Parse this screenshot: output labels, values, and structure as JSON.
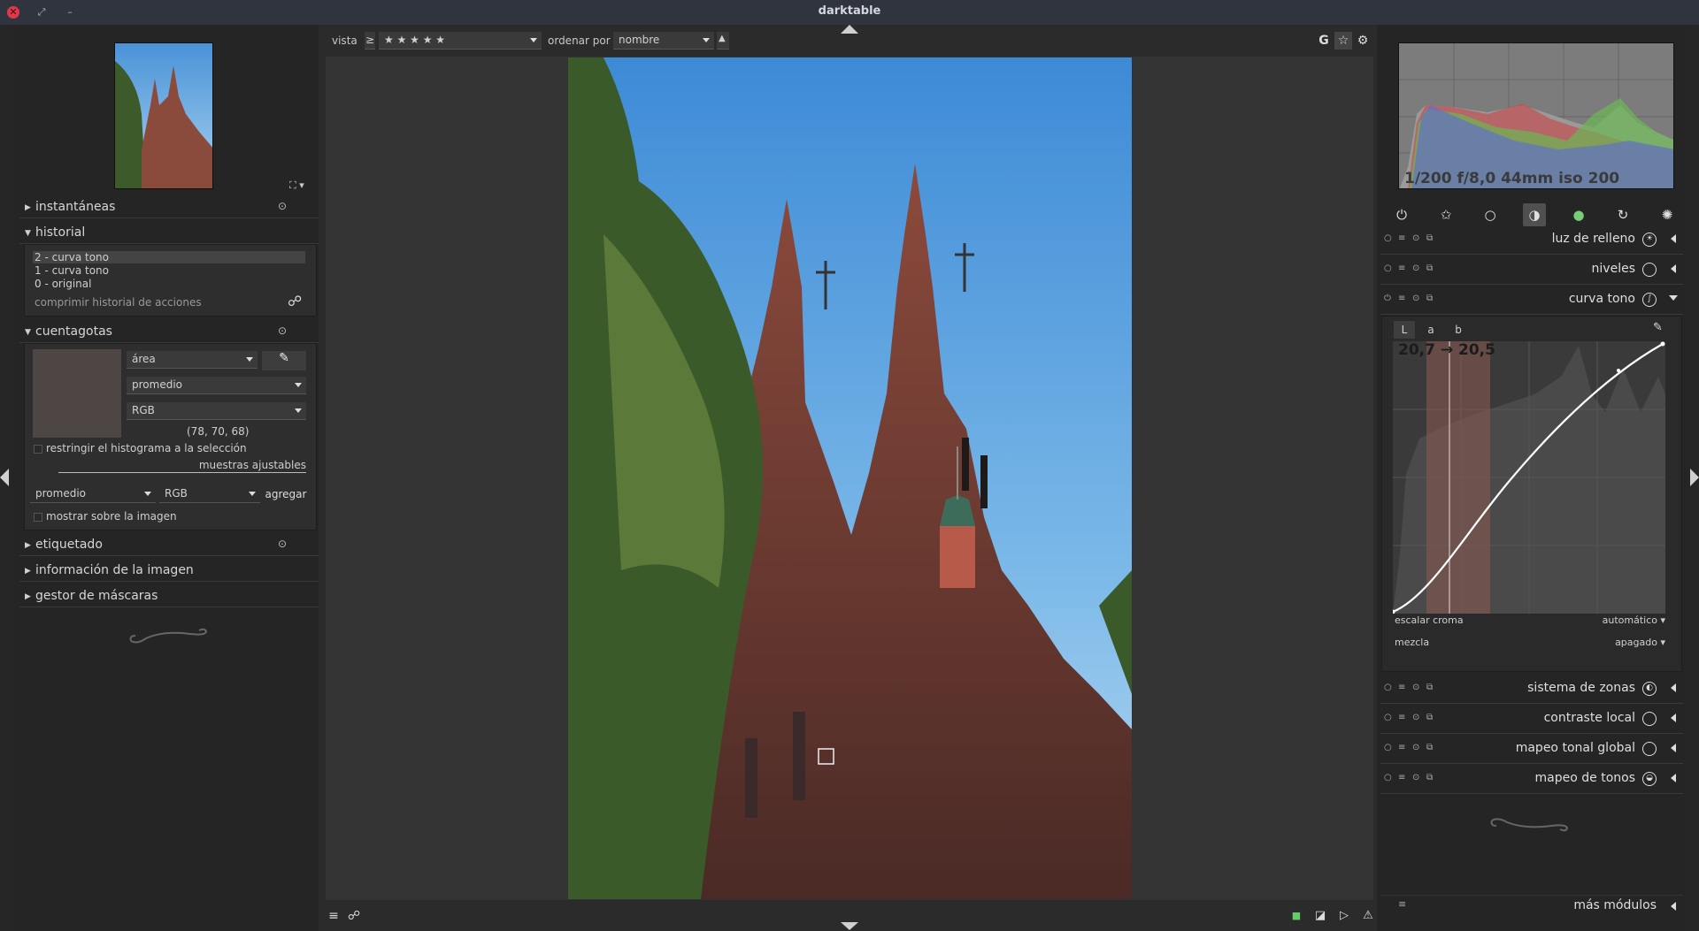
{
  "window": {
    "title": "darktable"
  },
  "topbar": {
    "view_label": "vista",
    "comparator": "≥",
    "rating_value": "★ ★ ★ ★ ★",
    "sort_label": "ordenar por",
    "sort_value": "nombre",
    "sort_dir": "▲",
    "grouping": "G"
  },
  "left": {
    "snapshots": {
      "label": "instantáneas"
    },
    "history": {
      "label": "historial",
      "items": [
        "2 - curva tono",
        "1 - curva tono",
        "0 - original"
      ],
      "compress_label": "comprimir historial de acciones"
    },
    "picker": {
      "label": "cuentagotas",
      "mode_value": "área",
      "stat_value": "promedio",
      "color_space_value": "RGB",
      "readout": "(78, 70, 68)",
      "restrict_label": "restringir el histograma a la selección",
      "live_samples_label": "muestras ajustables",
      "sample_stat_value": "promedio",
      "sample_space_value": "RGB",
      "add_label": "agregar",
      "show_on_image_label": "mostrar sobre la imagen",
      "swatch_color": "#4e4644"
    },
    "tagging": {
      "label": "etiquetado"
    },
    "image_info": {
      "label": "información de la imagen"
    },
    "mask_manager": {
      "label": "gestor de máscaras"
    }
  },
  "right": {
    "histogram_info": "1/200 f/8,0 44mm iso 200",
    "modules": [
      {
        "name": "luz de relleno",
        "expanded": false
      },
      {
        "name": "niveles",
        "expanded": false
      },
      {
        "name": "curva tono",
        "expanded": true
      },
      {
        "name": "sistema de zonas",
        "expanded": false
      },
      {
        "name": "contraste local",
        "expanded": false
      },
      {
        "name": "mapeo tonal global",
        "expanded": false
      },
      {
        "name": "mapeo de tonos",
        "expanded": false
      }
    ],
    "tone_curve": {
      "tabs": [
        "L",
        "a",
        "b"
      ],
      "readout": "20,7 → 20,5",
      "chroma_label": "escalar croma",
      "chroma_value": "automático",
      "blend_label": "mezcla",
      "blend_value": "apagado"
    },
    "more_modules_label": "más módulos"
  }
}
